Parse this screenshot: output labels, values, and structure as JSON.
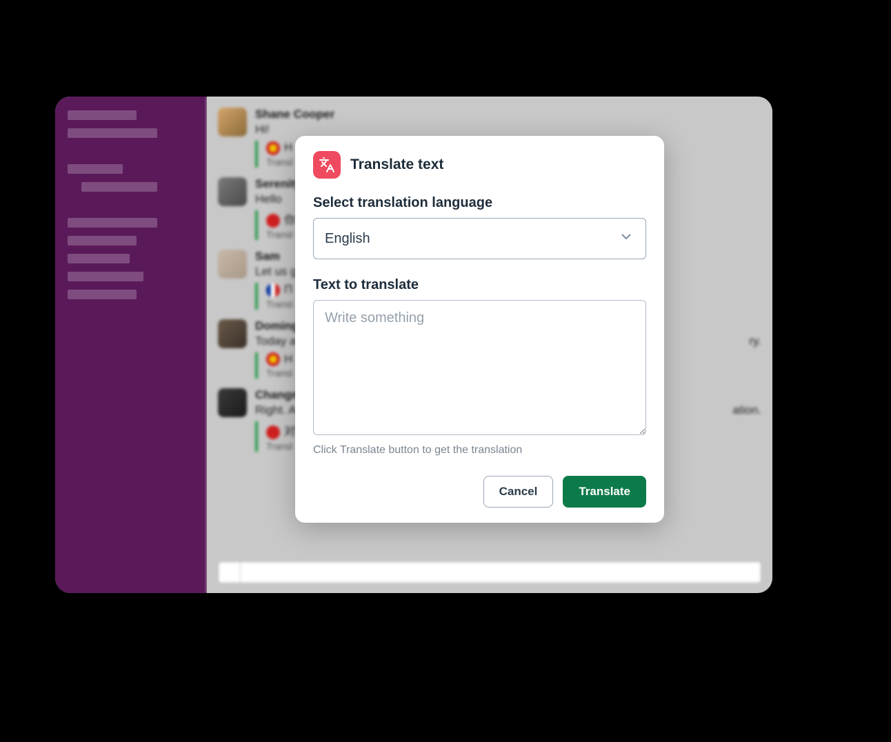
{
  "sidebar": {
    "items_widths": [
      100,
      130,
      0,
      80,
      110,
      0,
      130,
      100,
      90,
      110,
      100
    ]
  },
  "messages": [
    {
      "name": "Shane Cooper",
      "text": "Hi!",
      "trans_preview": "H",
      "trans_sub": "Transl",
      "flag": "es",
      "avatar": "av1"
    },
    {
      "name": "Serenity",
      "text": "Hello",
      "trans_preview": "你",
      "trans_sub": "Transl",
      "flag": "cn",
      "avatar": "av2"
    },
    {
      "name": "Sam",
      "text": "Let us g",
      "trans_preview": "П",
      "trans_sub": "Transl",
      "flag": "fr",
      "avatar": "av3"
    },
    {
      "name": "Doming",
      "text": "Today a",
      "trans_preview": "H",
      "trans_sub": "Transl",
      "text_suffix": "ry.",
      "flag": "es",
      "avatar": "av4"
    },
    {
      "name": "Changm",
      "text": "Right. A",
      "trans_preview": "对",
      "trans_sub": "Transl",
      "text_suffix": "ation.",
      "flag": "cn",
      "avatar": "av5"
    }
  ],
  "modal": {
    "title": "Translate text",
    "language_label": "Select translation language",
    "language_selected": "English",
    "text_label": "Text to translate",
    "textarea_placeholder": "Write something",
    "helper": "Click Translate button to get the translation",
    "cancel": "Cancel",
    "submit": "Translate"
  },
  "colors": {
    "sidebar": "#5a1a5a",
    "accent": "#ef4a5f",
    "primary_button": "#0d7a4a"
  }
}
